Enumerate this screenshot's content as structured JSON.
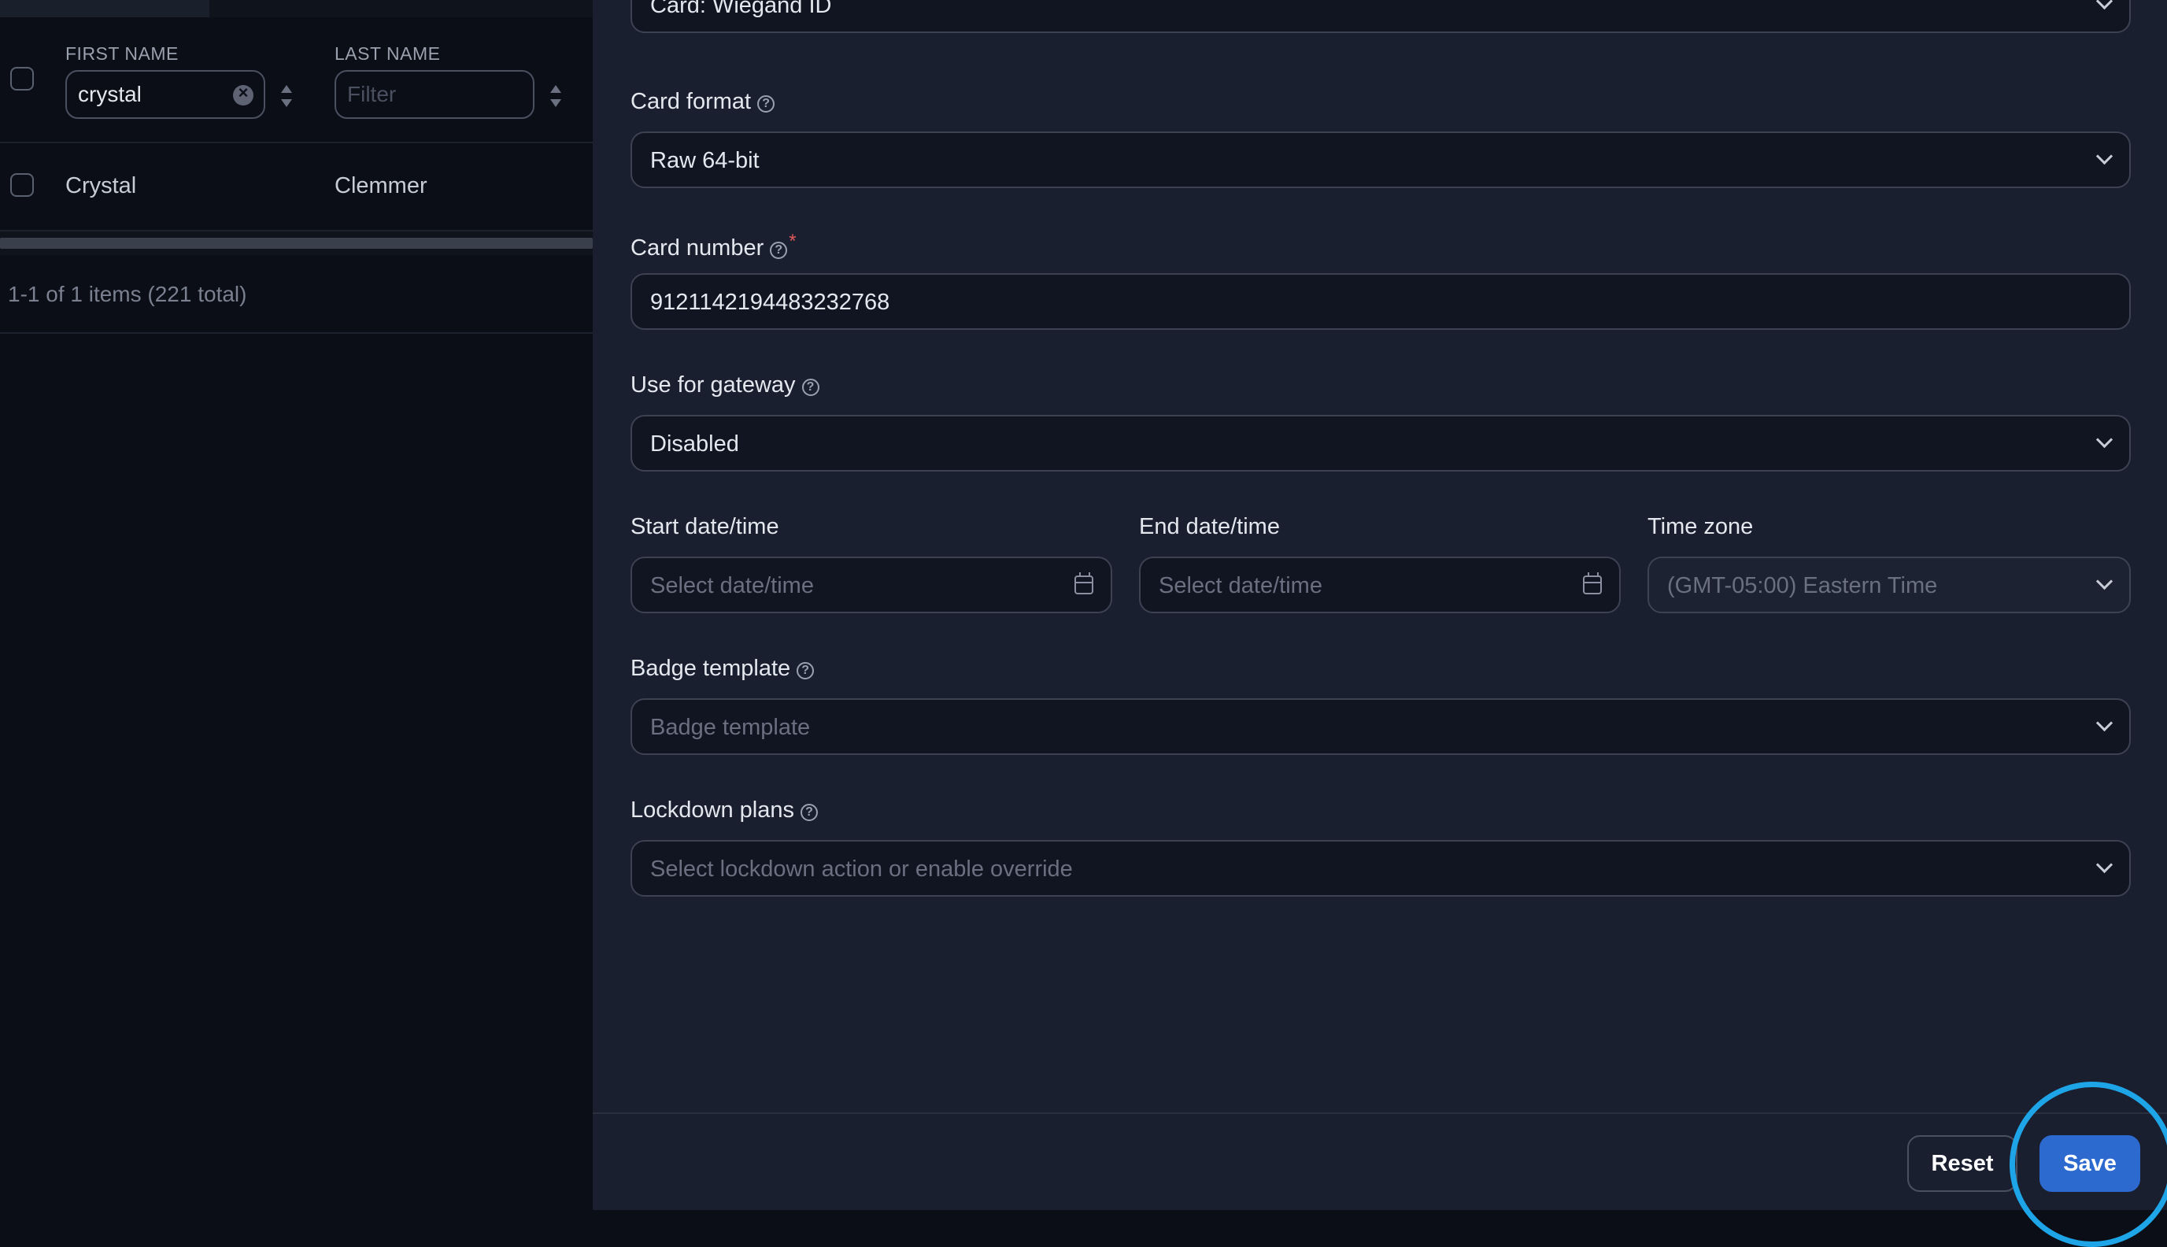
{
  "table": {
    "columns": [
      {
        "label": "FIRST NAME",
        "filter_value": "crystal",
        "filter_placeholder": "Filter"
      },
      {
        "label": "LAST NAME",
        "filter_value": "",
        "filter_placeholder": "Filter"
      }
    ],
    "rows": [
      {
        "first_name": "Crystal",
        "last_name": "Clemmer"
      }
    ],
    "pagination": "1-1 of 1 items (221 total)"
  },
  "form": {
    "credential_type": {
      "value": "Card: Wiegand ID"
    },
    "card_format": {
      "label": "Card format",
      "value": "Raw 64-bit"
    },
    "card_number": {
      "label": "Card number",
      "required_mark": "*",
      "value": "9121142194483232768"
    },
    "gateway": {
      "label": "Use for gateway",
      "value": "Disabled"
    },
    "start_datetime": {
      "label": "Start date/time",
      "placeholder": "Select date/time"
    },
    "end_datetime": {
      "label": "End date/time",
      "placeholder": "Select date/time"
    },
    "timezone": {
      "label": "Time zone",
      "value": "(GMT-05:00) Eastern Time"
    },
    "badge_template": {
      "label": "Badge template",
      "placeholder": "Badge template"
    },
    "lockdown_plans": {
      "label": "Lockdown plans",
      "placeholder": "Select lockdown action or enable override"
    },
    "help_glyph": "?"
  },
  "footer": {
    "reset_label": "Reset",
    "save_label": "Save"
  },
  "colors": {
    "accent": "#2c6ad0",
    "highlight_ring": "#1ea5e8",
    "required": "#e05a5a"
  }
}
